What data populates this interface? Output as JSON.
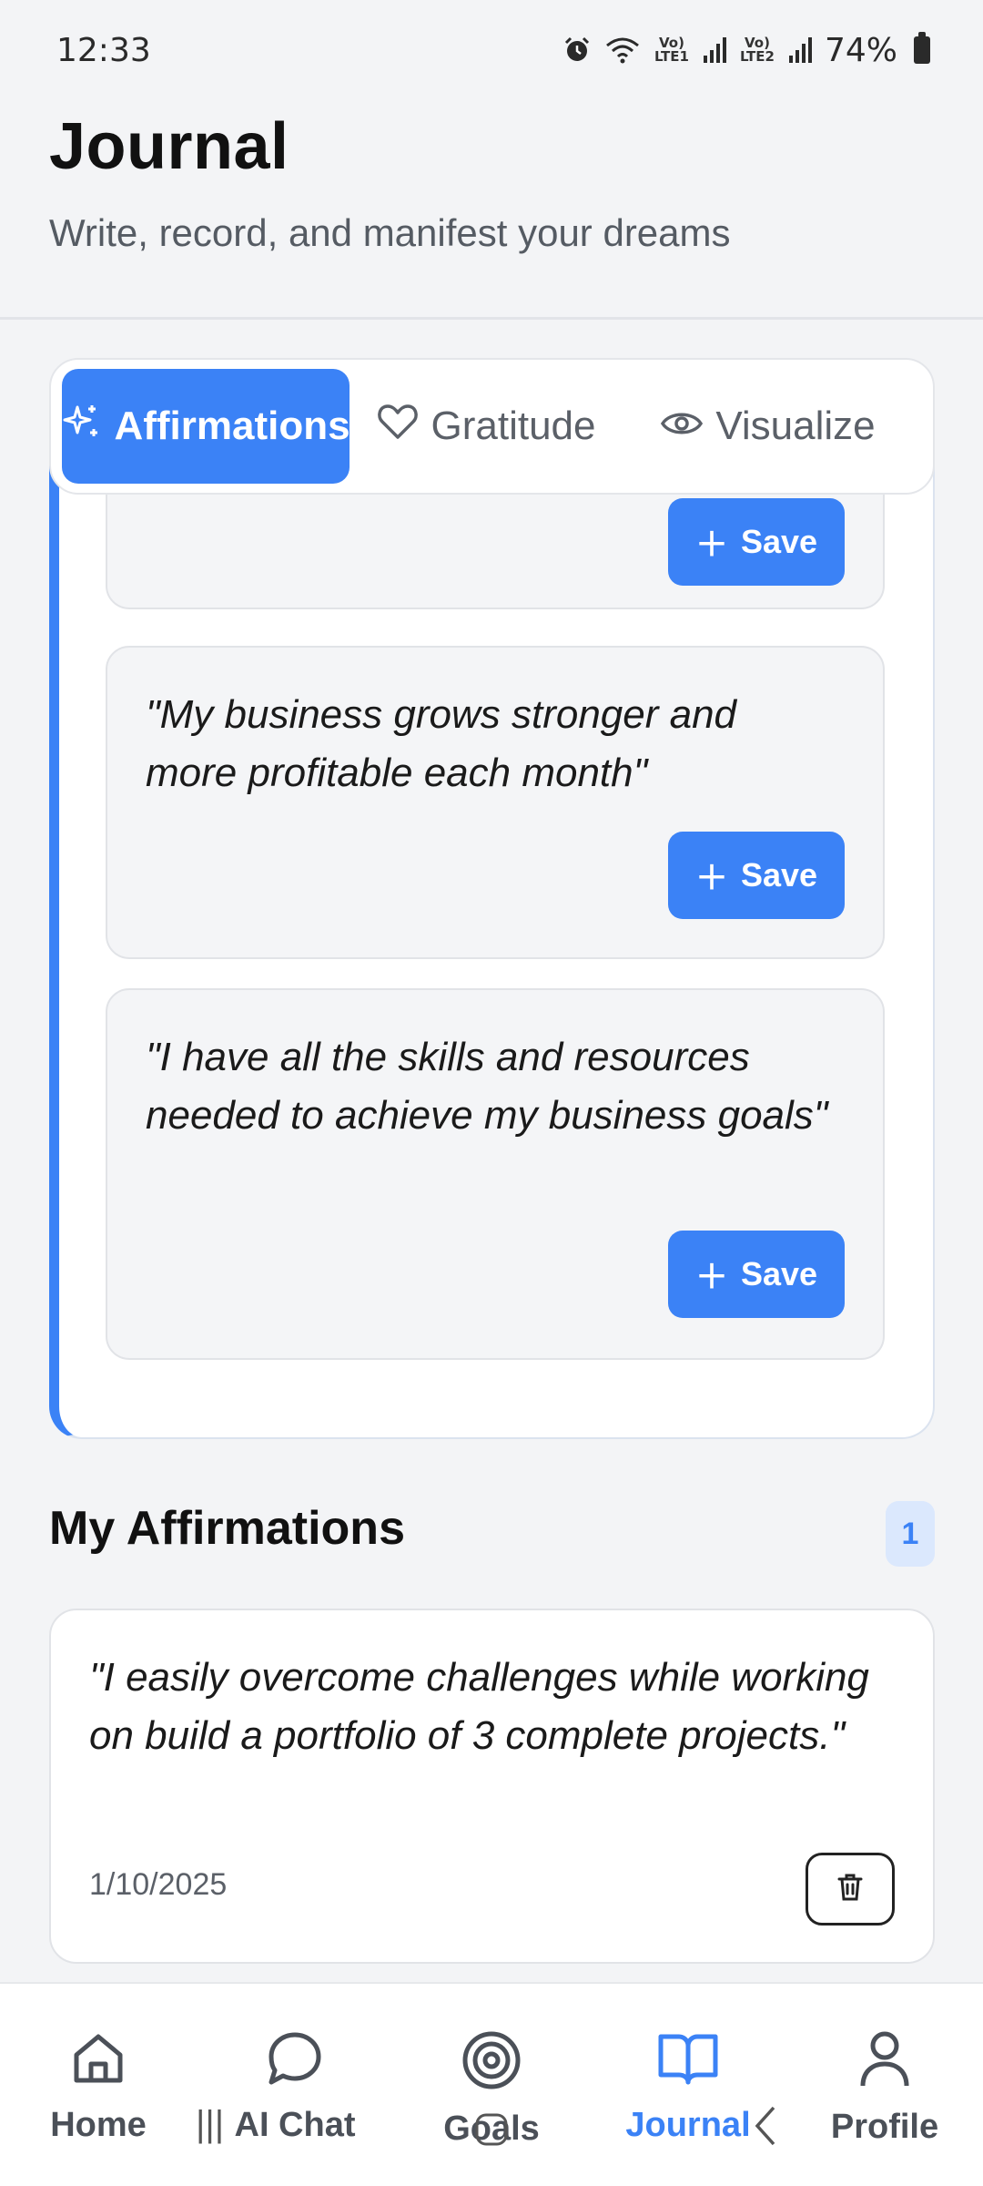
{
  "status_bar": {
    "time": "12:33",
    "lte1": "Vo) LTE1",
    "lte2": "Vo) LTE2",
    "battery": "74%"
  },
  "header": {
    "title": "Journal",
    "subtitle": "Write, record, and manifest your dreams"
  },
  "tabs": [
    {
      "label": "Affirmations",
      "icon": "sparkles-icon",
      "active": true
    },
    {
      "label": "Gratitude",
      "icon": "heart-icon",
      "active": false
    },
    {
      "label": "Visualize",
      "icon": "eye-icon",
      "active": false
    }
  ],
  "suggestions": [
    {
      "text": "",
      "save_label": "Save"
    },
    {
      "text": "\"My business grows stronger and more profitable each month\"",
      "save_label": "Save"
    },
    {
      "text": "\"I have all the skills and resources needed to achieve my business goals\"",
      "save_label": "Save"
    }
  ],
  "my_affirmations": {
    "title": "My Affirmations",
    "count": "1",
    "items": [
      {
        "text": "\"I easily overcome challenges while working on build a portfolio of 3 complete projects.\"",
        "date": "1/10/2025"
      }
    ]
  },
  "bottom_nav": [
    {
      "label": "Home",
      "icon": "home-icon",
      "active": false
    },
    {
      "label": "AI Chat",
      "icon": "chat-bubble-icon",
      "active": false
    },
    {
      "label": "Goals",
      "icon": "target-icon",
      "active": false
    },
    {
      "label": "Journal",
      "icon": "book-open-icon",
      "active": true
    },
    {
      "label": "Profile",
      "icon": "user-icon",
      "active": false
    }
  ],
  "colors": {
    "accent": "#3b82f6",
    "background": "#f3f4f6",
    "card": "#ffffff"
  }
}
